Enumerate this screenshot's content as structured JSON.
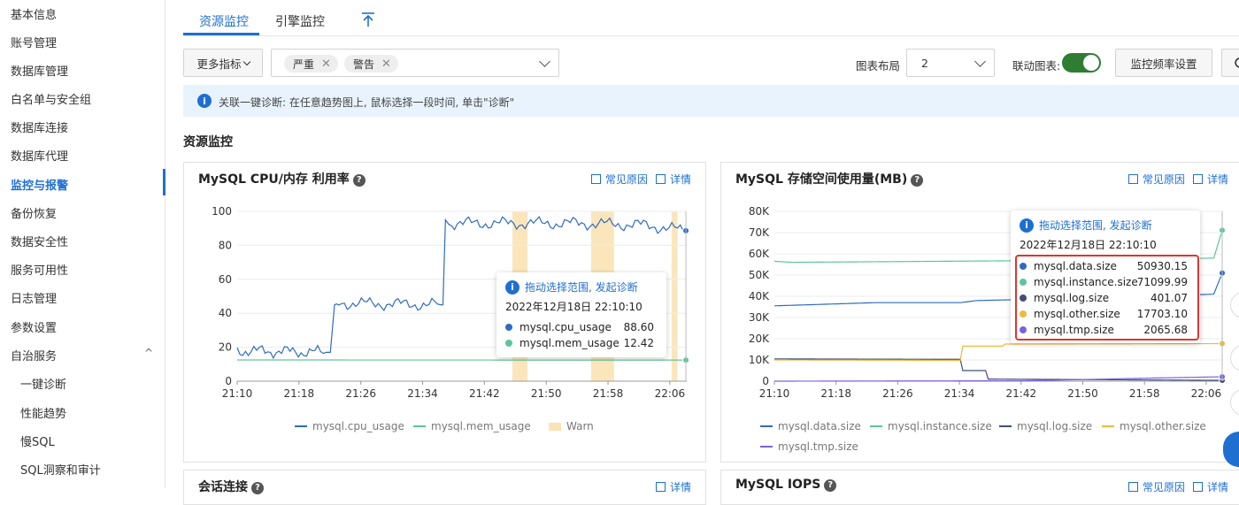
{
  "sidebar": {
    "items": [
      {
        "label": "基本信息"
      },
      {
        "label": "账号管理"
      },
      {
        "label": "数据库管理"
      },
      {
        "label": "白名单与安全组"
      },
      {
        "label": "数据库连接"
      },
      {
        "label": "数据库代理"
      },
      {
        "label": "监控与报警"
      },
      {
        "label": "备份恢复"
      },
      {
        "label": "数据安全性"
      },
      {
        "label": "服务可用性"
      },
      {
        "label": "日志管理"
      },
      {
        "label": "参数设置"
      },
      {
        "label": "自治服务"
      },
      {
        "label": "一键诊断"
      },
      {
        "label": "性能趋势"
      },
      {
        "label": "慢SQL"
      },
      {
        "label": "SQL洞察和审计"
      }
    ],
    "chevron": "^"
  },
  "tabs": [
    {
      "label": "资源监控"
    },
    {
      "label": "引擎监控"
    }
  ],
  "toolbar": {
    "more_metrics": "更多指标",
    "filter_tags": [
      {
        "label": "严重"
      },
      {
        "label": "警告"
      }
    ],
    "layout_label": "图表布局",
    "layout_value": "2",
    "linked_label": "联动图表:",
    "frequency_button": "监控频率设置"
  },
  "info_bar": {
    "text": "关联一键诊断: 在任意趋势图上, 鼠标选择一段时间, 单击\"诊断\""
  },
  "section_title": "资源监控",
  "cards": {
    "cpu": {
      "title": "MySQL CPU/内存 利用率",
      "link_reason": "常见原因",
      "link_detail": "详情"
    },
    "storage": {
      "title": "MySQL 存储空间使用量(MB)",
      "link_reason": "常见原因",
      "link_detail": "详情"
    },
    "sessions": {
      "title": "会话连接",
      "link_detail": "详情"
    },
    "iops": {
      "title": "MySQL IOPS",
      "link_reason": "常见原因",
      "link_detail": "详情"
    }
  },
  "tooltips": {
    "cpu": {
      "head": "拖动选择范围, 发起诊断",
      "date": "2022年12月18日 22:10:10",
      "rows": [
        {
          "name": "mysql.cpu_usage",
          "value": "88.60",
          "color": "#2f6cc0"
        },
        {
          "name": "mysql.mem_usage",
          "value": "12.42",
          "color": "#5cc69a"
        }
      ]
    },
    "storage": {
      "head": "拖动选择范围, 发起诊断",
      "date": "2022年12月18日 22:10:10",
      "rows": [
        {
          "name": "mysql.data.size",
          "value": "50930.15",
          "color": "#2f6cc0"
        },
        {
          "name": "mysql.instance.size",
          "value": "71099.99",
          "color": "#5cc69a"
        },
        {
          "name": "mysql.log.size",
          "value": "401.07",
          "color": "#3f4f7a"
        },
        {
          "name": "mysql.other.size",
          "value": "17703.10",
          "color": "#f0b93a"
        },
        {
          "name": "mysql.tmp.size",
          "value": "2065.68",
          "color": "#7b61e0"
        }
      ]
    }
  },
  "chart_data": [
    {
      "type": "line",
      "title": "MySQL CPU/内存 利用率",
      "x_ticks": [
        "21:10",
        "21:18",
        "21:26",
        "21:34",
        "21:42",
        "21:50",
        "21:58",
        "22:06"
      ],
      "y_ticks": [
        "0",
        "20",
        "40",
        "60",
        "80",
        "100"
      ],
      "ylim": [
        0,
        100
      ],
      "series": [
        {
          "name": "mysql.cpu_usage",
          "color": "#2f6cc0",
          "points": [
            [
              0,
              18
            ],
            [
              10.5,
              17
            ],
            [
              11,
              17
            ],
            [
              11.5,
              45
            ],
            [
              12,
              46
            ],
            [
              24,
              45
            ],
            [
              24.3,
              45
            ],
            [
              24.6,
              95
            ],
            [
              25,
              93
            ],
            [
              40,
              93
            ],
            [
              48,
              92
            ],
            [
              53,
              88.6
            ]
          ]
        },
        {
          "name": "mysql.mem_usage",
          "color": "#5cc69a",
          "points": [
            [
              0,
              12.5
            ],
            [
              53,
              12.42
            ]
          ]
        }
      ],
      "warn_bands": [
        [
          32.5,
          34.3
        ],
        [
          41.8,
          44.5
        ],
        [
          51.3,
          52
        ]
      ],
      "legend": [
        "mysql.cpu_usage",
        "mysql.mem_usage",
        "Warn"
      ]
    },
    {
      "type": "line",
      "title": "MySQL 存储空间使用量(MB)",
      "x_ticks": [
        "21:10",
        "21:18",
        "21:26",
        "21:34",
        "21:42",
        "21:50",
        "21:58",
        "22:06"
      ],
      "y_ticks": [
        "0",
        "10K",
        "20K",
        "30K",
        "40K",
        "50K",
        "60K",
        "70K",
        "80K"
      ],
      "ylim": [
        0,
        80000
      ],
      "series": [
        {
          "name": "mysql.data.size",
          "color": "#2f6cc0",
          "points": [
            [
              0,
              35500
            ],
            [
              4,
              36000
            ],
            [
              12,
              37000
            ],
            [
              22,
              37000
            ],
            [
              24,
              38000
            ],
            [
              36,
              39000
            ],
            [
              52,
              41000
            ],
            [
              53,
              50930
            ]
          ]
        },
        {
          "name": "mysql.instance.size",
          "color": "#5cc69a",
          "points": [
            [
              0,
              56500
            ],
            [
              2,
              56000
            ],
            [
              20,
              56500
            ],
            [
              40,
              57000
            ],
            [
              52,
              58000
            ],
            [
              53,
              71100
            ]
          ]
        },
        {
          "name": "mysql.log.size",
          "color": "#3f4f7a",
          "points": [
            [
              0,
              10500
            ],
            [
              20,
              10300
            ],
            [
              22,
              10300
            ],
            [
              22.3,
              5000
            ],
            [
              25,
              5000
            ],
            [
              25.3,
              1000
            ],
            [
              53,
              401
            ]
          ]
        },
        {
          "name": "mysql.other.size",
          "color": "#f0b93a",
          "points": [
            [
              0,
              10000
            ],
            [
              22,
              9800
            ],
            [
              22.3,
              16500
            ],
            [
              27,
              16500
            ],
            [
              27.3,
              17500
            ],
            [
              53,
              17703
            ]
          ]
        },
        {
          "name": "mysql.tmp.size",
          "color": "#7b61e0",
          "points": [
            [
              0,
              0
            ],
            [
              30,
              200
            ],
            [
              45,
              1500
            ],
            [
              53,
              2066
            ]
          ]
        }
      ],
      "legend": [
        "mysql.data.size",
        "mysql.instance.size",
        "mysql.log.size",
        "mysql.other.size",
        "mysql.tmp.size"
      ]
    }
  ]
}
